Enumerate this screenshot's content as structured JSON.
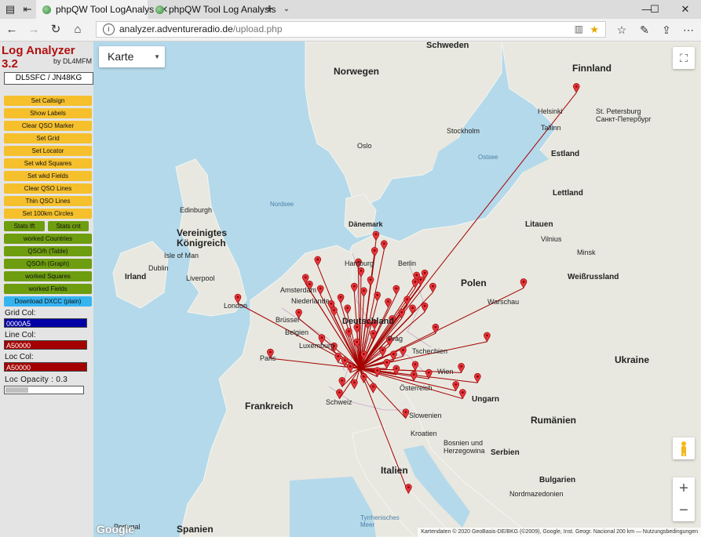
{
  "browser": {
    "tabs": [
      {
        "label": "phpQW Tool LogAnalys",
        "active": true
      },
      {
        "label": "phpQW Tool Log Analysis",
        "active": false
      }
    ],
    "url_host": "analyzer.adventureradio.de",
    "url_path": "/upload.php"
  },
  "panel": {
    "title": "Log Analyzer 3.2",
    "subtitle": "by DL4MFM",
    "callsign": "DL5SFC / JN48KG",
    "buttons": {
      "set_callsign": "Set Callsign",
      "show_labels": "Show Labels",
      "clear_qso_marker": "Clear QSO Marker",
      "set_grid": "Set Grid",
      "set_locator": "Set Locator",
      "set_wkd_squares": "Set wkd Squares",
      "set_wkd_fields": "Set wkd Fields",
      "clear_qso_lines": "Clear QSO Lines",
      "thin_qso_lines": "Thin QSO Lines",
      "set_100km_circles": "Set 100km Circles",
      "stats_lft": "Stats lft",
      "stats_cnt": "Stats cnt",
      "worked_countries": "worked Countries",
      "qso_h_table": "QSO/h (Table)",
      "qso_h_graph": "QSO/h (Graph)",
      "worked_squares": "worked Squares",
      "worked_fields": "worked Fields",
      "download_dxcc": "Download DXCC (plain)"
    },
    "grid_col_label": "Grid Col:",
    "grid_col_value": "0000A5",
    "line_col_label": "Line Col:",
    "line_col_value": "A50000",
    "loc_col_label": "Loc Col:",
    "loc_col_value": "A50000",
    "loc_opacity_label": "Loc Opacity : 0.3",
    "loc_opacity": 0.3
  },
  "colors": {
    "grid_col": "#0000A5",
    "line_col": "#A50000",
    "loc_col": "#A50000",
    "button_yellow": "#F6C02D",
    "button_green": "#6E9D0F",
    "button_blue": "#35B4F0",
    "title_red": "#B01010"
  },
  "map": {
    "map_type": "Karte",
    "attribution": "Kartendaten © 2020 GeoBasis-DE/BKG (©2009), Google, Inst. Geogr. Nacional   200 km ⎯⎯   Nutzungsbedingungen",
    "google": "Google",
    "labels": {
      "schweden": "Schweden",
      "norwegen": "Norwegen",
      "finnland": "Finnland",
      "helsinki": "Helsinki",
      "st_petersburg": "St. Petersburg\nСанкт-Петербург",
      "tallinn": "Tallinn",
      "estland": "Estland",
      "oslo": "Oslo",
      "stockholm": "Stockholm",
      "ostsee": "Ostsee",
      "lettland": "Lettland",
      "litauen": "Litauen",
      "nordsee": "Nordsee",
      "daenemark": "Dänemark",
      "edinburgh": "Edinburgh",
      "vereinigtes": "Vereinigtes\nKönigreich",
      "isle_of_man": "Isle of Man",
      "irland": "Irland",
      "dublin": "Dublin",
      "liverpool": "Liverpool",
      "hamburg": "Hamburg",
      "amsterdam": "Amsterdam",
      "niederlande": "Niederlande",
      "berlin": "Berlin",
      "polen": "Polen",
      "warschau": "Warschau",
      "minsk": "Minsk",
      "weissrussland": "Weißrussland",
      "vilnius": "Vilnius",
      "london": "London",
      "bruessel": "Brüssel",
      "belgien": "Belgien",
      "luxemburg": "Luxemburg",
      "deutschland": "Deutschland",
      "tschechien": "Tschechien",
      "prag": "Prag",
      "ukraine": "Ukraine",
      "paris": "Paris",
      "frankreich": "Frankreich",
      "wien": "Wien",
      "oesterreich": "Österreich",
      "ungarn": "Ungarn",
      "schweiz": "Schweiz",
      "slowenien": "Slowenien",
      "kroatien": "Kroatien",
      "rumaenien": "Rumänien",
      "bosnien": "Bosnien und\nHerzegowina",
      "serbien": "Serbien",
      "italien": "Italien",
      "bulgarien": "Bulgarien",
      "normazedonien": "Nordmazedonien",
      "tyrrhenisches": "Tyrrhenisches\nMeer",
      "spanien": "Spanien",
      "portugal": "Portugal"
    },
    "home": {
      "lat": 48.4,
      "lon": 8.9
    },
    "markers": [
      {
        "lat": 51.5,
        "lon": -0.1
      },
      {
        "lat": 48.9,
        "lon": 2.3
      },
      {
        "lat": 50.8,
        "lon": 4.4
      },
      {
        "lat": 52.4,
        "lon": 4.9
      },
      {
        "lat": 52.1,
        "lon": 5.2
      },
      {
        "lat": 51.9,
        "lon": 6.0
      },
      {
        "lat": 53.6,
        "lon": 10.0
      },
      {
        "lat": 54.3,
        "lon": 10.1
      },
      {
        "lat": 53.9,
        "lon": 10.7
      },
      {
        "lat": 53.2,
        "lon": 5.8
      },
      {
        "lat": 52.3,
        "lon": 13.4
      },
      {
        "lat": 52.5,
        "lon": 13.1
      },
      {
        "lat": 52.2,
        "lon": 13.0
      },
      {
        "lat": 52.6,
        "lon": 13.7
      },
      {
        "lat": 52.0,
        "lon": 14.3
      },
      {
        "lat": 52.2,
        "lon": 21.0
      },
      {
        "lat": 60.2,
        "lon": 24.9
      },
      {
        "lat": 50.1,
        "lon": 14.5
      },
      {
        "lat": 49.7,
        "lon": 18.3
      },
      {
        "lat": 48.2,
        "lon": 16.4
      },
      {
        "lat": 47.7,
        "lon": 17.6
      },
      {
        "lat": 47.3,
        "lon": 16.0
      },
      {
        "lat": 46.9,
        "lon": 16.5
      },
      {
        "lat": 45.9,
        "lon": 12.3
      },
      {
        "lat": 41.9,
        "lon": 12.5
      },
      {
        "lat": 52.0,
        "lon": 8.5
      },
      {
        "lat": 51.5,
        "lon": 7.5
      },
      {
        "lat": 51.2,
        "lon": 6.8
      },
      {
        "lat": 50.9,
        "lon": 7.0
      },
      {
        "lat": 51.0,
        "lon": 8.0
      },
      {
        "lat": 51.8,
        "lon": 9.2
      },
      {
        "lat": 51.6,
        "lon": 10.2
      },
      {
        "lat": 51.3,
        "lon": 11.0
      },
      {
        "lat": 51.4,
        "lon": 12.4
      },
      {
        "lat": 51.0,
        "lon": 12.8
      },
      {
        "lat": 51.1,
        "lon": 13.7
      },
      {
        "lat": 50.8,
        "lon": 12.0
      },
      {
        "lat": 50.5,
        "lon": 11.3
      },
      {
        "lat": 50.3,
        "lon": 10.0
      },
      {
        "lat": 50.1,
        "lon": 8.7
      },
      {
        "lat": 49.9,
        "lon": 8.1
      },
      {
        "lat": 49.4,
        "lon": 8.7
      },
      {
        "lat": 49.5,
        "lon": 11.1
      },
      {
        "lat": 49.0,
        "lon": 12.1
      },
      {
        "lat": 48.8,
        "lon": 11.4
      },
      {
        "lat": 48.4,
        "lon": 10.9
      },
      {
        "lat": 48.1,
        "lon": 11.6
      },
      {
        "lat": 47.8,
        "lon": 12.9
      },
      {
        "lat": 48.0,
        "lon": 10.2
      },
      {
        "lat": 47.7,
        "lon": 9.2
      },
      {
        "lat": 48.2,
        "lon": 8.2
      },
      {
        "lat": 48.5,
        "lon": 7.8
      },
      {
        "lat": 48.8,
        "lon": 9.2
      },
      {
        "lat": 48.7,
        "lon": 7.3
      },
      {
        "lat": 49.2,
        "lon": 7.0
      },
      {
        "lat": 49.6,
        "lon": 6.1
      },
      {
        "lat": 47.5,
        "lon": 7.6
      },
      {
        "lat": 46.9,
        "lon": 7.4
      },
      {
        "lat": 47.4,
        "lon": 8.5
      },
      {
        "lat": 47.2,
        "lon": 9.9
      },
      {
        "lat": 50.3,
        "lon": 9.5
      },
      {
        "lat": 51.9,
        "lon": 11.6
      },
      {
        "lat": 52.3,
        "lon": 9.7
      },
      {
        "lat": 52.7,
        "lon": 9.0
      },
      {
        "lat": 53.1,
        "lon": 8.8
      },
      {
        "lat": 49.8,
        "lon": 9.9
      },
      {
        "lat": 49.0,
        "lon": 10.6
      },
      {
        "lat": 48.3,
        "lon": 13.0
      },
      {
        "lat": 47.9,
        "lon": 14.0
      }
    ]
  }
}
